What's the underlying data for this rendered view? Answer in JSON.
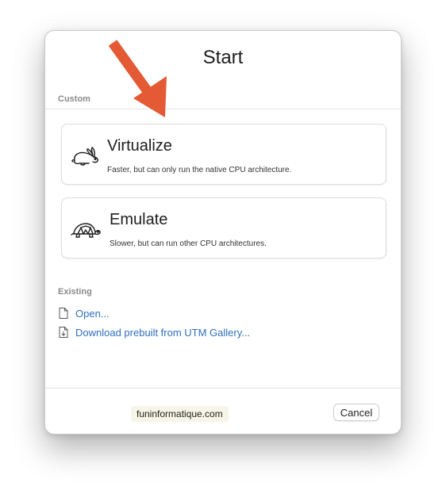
{
  "window": {
    "title": "Start"
  },
  "custom": {
    "label": "Custom",
    "options": [
      {
        "title": "Virtualize",
        "description": "Faster, but can only run the native CPU architecture.",
        "icon": "rabbit-icon"
      },
      {
        "title": "Emulate",
        "description": "Slower, but can run other CPU architectures.",
        "icon": "turtle-icon"
      }
    ]
  },
  "existing": {
    "label": "Existing",
    "links": [
      {
        "label": "Open...",
        "icon": "document-icon"
      },
      {
        "label": "Download prebuilt from UTM Gallery...",
        "icon": "download-document-icon"
      }
    ]
  },
  "footer": {
    "cancel_label": "Cancel",
    "watermark": "funinformatique.com"
  },
  "colors": {
    "link": "#2f6fc0",
    "arrow": "#e35a35",
    "section_label": "#8a8a8a"
  }
}
